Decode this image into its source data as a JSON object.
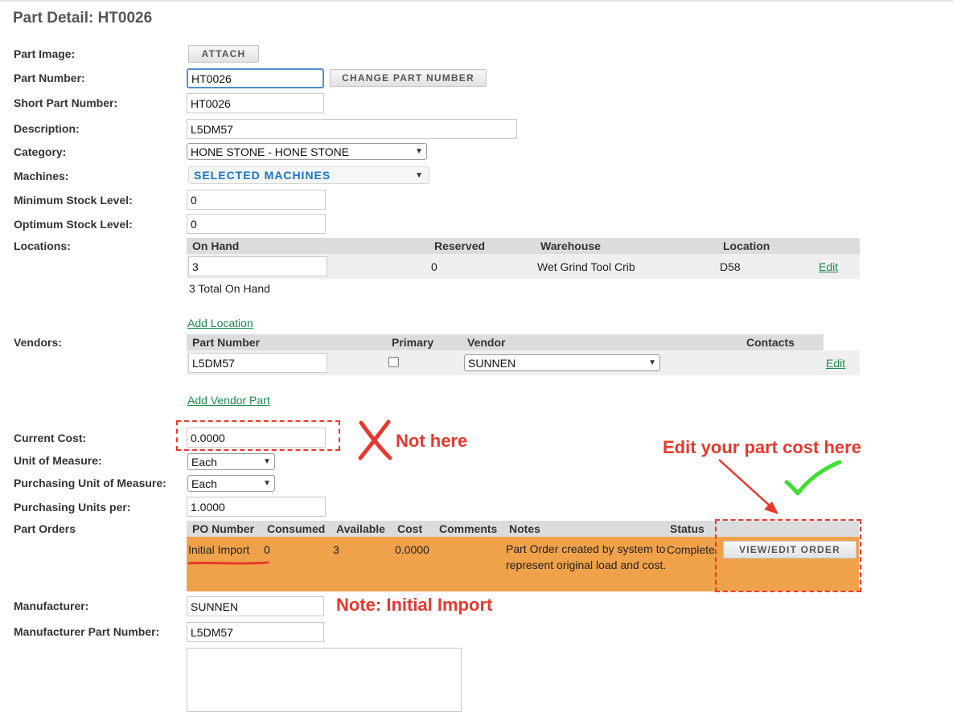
{
  "page": {
    "title": "Part Detail: HT0026"
  },
  "labels": {
    "part_image": "Part Image:",
    "part_number": "Part Number:",
    "short_part_number": "Short Part Number:",
    "description": "Description:",
    "category": "Category:",
    "machines": "Machines:",
    "min_stock": "Minimum Stock Level:",
    "opt_stock": "Optimum Stock Level:",
    "locations": "Locations:",
    "vendors": "Vendors:",
    "current_cost": "Current Cost:",
    "uom": "Unit of Measure:",
    "purchasing_uom": "Purchasing Unit of Measure:",
    "purchasing_units_per": "Purchasing Units per:",
    "part_orders": "Part Orders",
    "manufacturer": "Manufacturer:",
    "manufacturer_part_number": "Manufacturer Part Number:"
  },
  "buttons": {
    "attach": "ATTACH",
    "change_part_number": "CHANGE PART NUMBER",
    "view_edit_order": "VIEW/EDIT ORDER"
  },
  "fields": {
    "part_number": "HT0026",
    "short_part_number": "HT0026",
    "description": "L5DM57",
    "category": "HONE STONE - HONE STONE",
    "machines": "SELECTED MACHINES",
    "min_stock": "0",
    "opt_stock": "0",
    "current_cost": "0.0000",
    "uom": "Each",
    "purchasing_uom": "Each",
    "purchasing_units_per": "1.0000",
    "manufacturer": "SUNNEN",
    "manufacturer_part_number": "L5DM57"
  },
  "locations": {
    "headers": {
      "on_hand": "On Hand",
      "reserved": "Reserved",
      "warehouse": "Warehouse",
      "location": "Location"
    },
    "row": {
      "on_hand": "3",
      "reserved": "0",
      "warehouse": "Wet Grind Tool Crib",
      "location": "D58",
      "edit": "Edit"
    },
    "total": "3 Total On Hand",
    "add_link": "Add Location"
  },
  "vendors": {
    "headers": {
      "part_number": "Part Number",
      "primary": "Primary",
      "vendor": "Vendor",
      "contacts": "Contacts"
    },
    "row": {
      "part_number": "L5DM57",
      "primary": false,
      "vendor": "SUNNEN",
      "edit": "Edit"
    },
    "add_link": "Add Vendor Part"
  },
  "part_orders": {
    "headers": {
      "po_number": "PO Number",
      "consumed": "Consumed",
      "available": "Available",
      "cost": "Cost",
      "comments": "Comments",
      "notes": "Notes",
      "status": "Status"
    },
    "row": {
      "po_number": "Initial Import",
      "consumed": "0",
      "available": "3",
      "cost": "0.0000",
      "comments": "",
      "notes": "Part Order created by system to represent original load and cost.",
      "status": "Complete"
    }
  },
  "annotations": {
    "not_here": "Not here",
    "edit_here": "Edit your part cost here",
    "initial_import_note": "Note: Initial Import"
  },
  "icons": {
    "dropdown": "chevron-down-icon",
    "cross": "red-x-icon",
    "check": "green-check-icon",
    "arrow": "red-arrow-icon"
  },
  "colors": {
    "annotation_red": "#e8382e",
    "check_green": "#3ee02e",
    "order_row": "#f0a24a",
    "link_green": "#1a8a4a",
    "machines_blue": "#1a73c8"
  }
}
